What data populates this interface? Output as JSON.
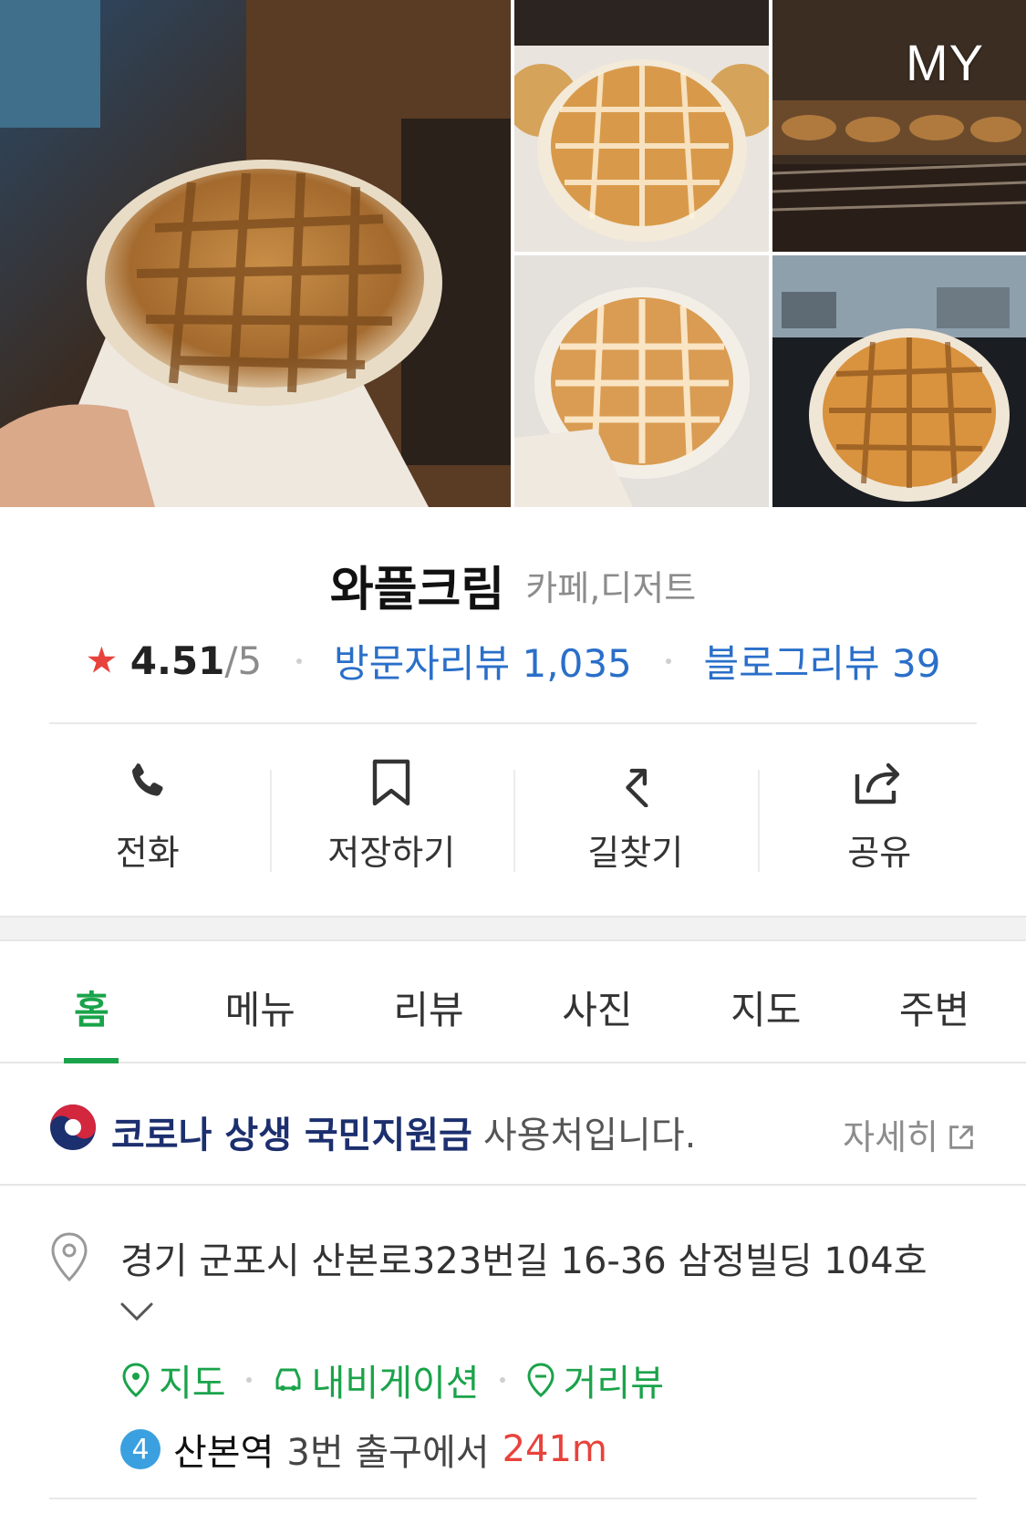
{
  "gallery": {
    "badge": "MY",
    "photos": [
      "waffle-in-hand",
      "waffle-on-paper",
      "bakery-display-case",
      "waffle-close-up",
      "waffle-in-car"
    ]
  },
  "place": {
    "name": "와플크림",
    "category": "카페,디저트",
    "rating": "4.51",
    "rating_max": "/5",
    "visitor_reviews": "방문자리뷰 1,035",
    "blog_reviews": "블로그리뷰 39"
  },
  "actions": {
    "call": "전화",
    "save": "저장하기",
    "directions": "길찾기",
    "share": "공유"
  },
  "tabs": [
    "홈",
    "메뉴",
    "리뷰",
    "사진",
    "지도",
    "주변"
  ],
  "active_tab": "홈",
  "banner": {
    "strong": "코로나 상생 국민지원금",
    "rest": "사용처입니다.",
    "more": "자세히"
  },
  "address": {
    "text": "경기 군포시 산본로323번길 16-36 삼정빌딩 104호",
    "links": {
      "map": "지도",
      "navigation": "내비게이션",
      "street_view": "거리뷰"
    },
    "subway": {
      "line": "4",
      "line_color": "#3aa0e0",
      "station": "산본역",
      "exit": "3번 출구에서",
      "distance": "241m"
    }
  },
  "colors": {
    "accent_green": "#1aa34a",
    "link_blue": "#2a6fc9",
    "star_red": "#e8423c",
    "banner_navy": "#1c2f6e"
  }
}
